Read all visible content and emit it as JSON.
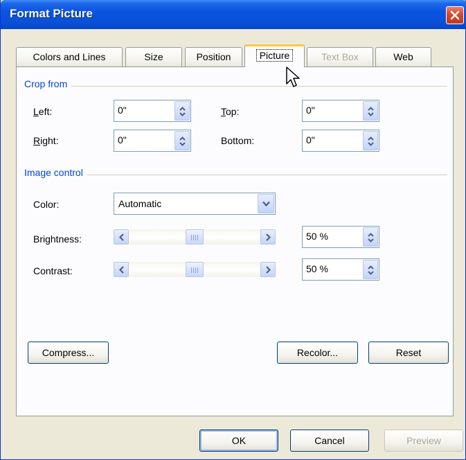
{
  "window": {
    "title": "Format Picture"
  },
  "tabs": [
    {
      "label": "Colors and Lines"
    },
    {
      "label": "Size"
    },
    {
      "label": "Position"
    },
    {
      "label": "Picture"
    },
    {
      "label": "Text Box"
    },
    {
      "label": "Web"
    }
  ],
  "crop": {
    "group_label": "Crop from",
    "left_label": "Left:",
    "left_value": "0\"",
    "right_label": "Right:",
    "right_value": "0\"",
    "top_label": "Top:",
    "top_value": "0\"",
    "bottom_label": "Bottom:",
    "bottom_value": "0\""
  },
  "image_control": {
    "group_label": "Image control",
    "color_label": "Color:",
    "color_value": "Automatic",
    "brightness_label": "Brightness:",
    "brightness_value": "50 %",
    "brightness_level": 0.5,
    "contrast_label": "Contrast:",
    "contrast_value": "50 %",
    "contrast_level": 0.5
  },
  "buttons": {
    "compress": "Compress...",
    "recolor": "Recolor...",
    "reset": "Reset",
    "ok": "OK",
    "cancel": "Cancel",
    "preview": "Preview"
  },
  "colors": {
    "title_bar": "#0a55df",
    "group_label": "#0046d5",
    "active_tab_highlight": "#ffc83c",
    "close_button": "#d8482b"
  }
}
